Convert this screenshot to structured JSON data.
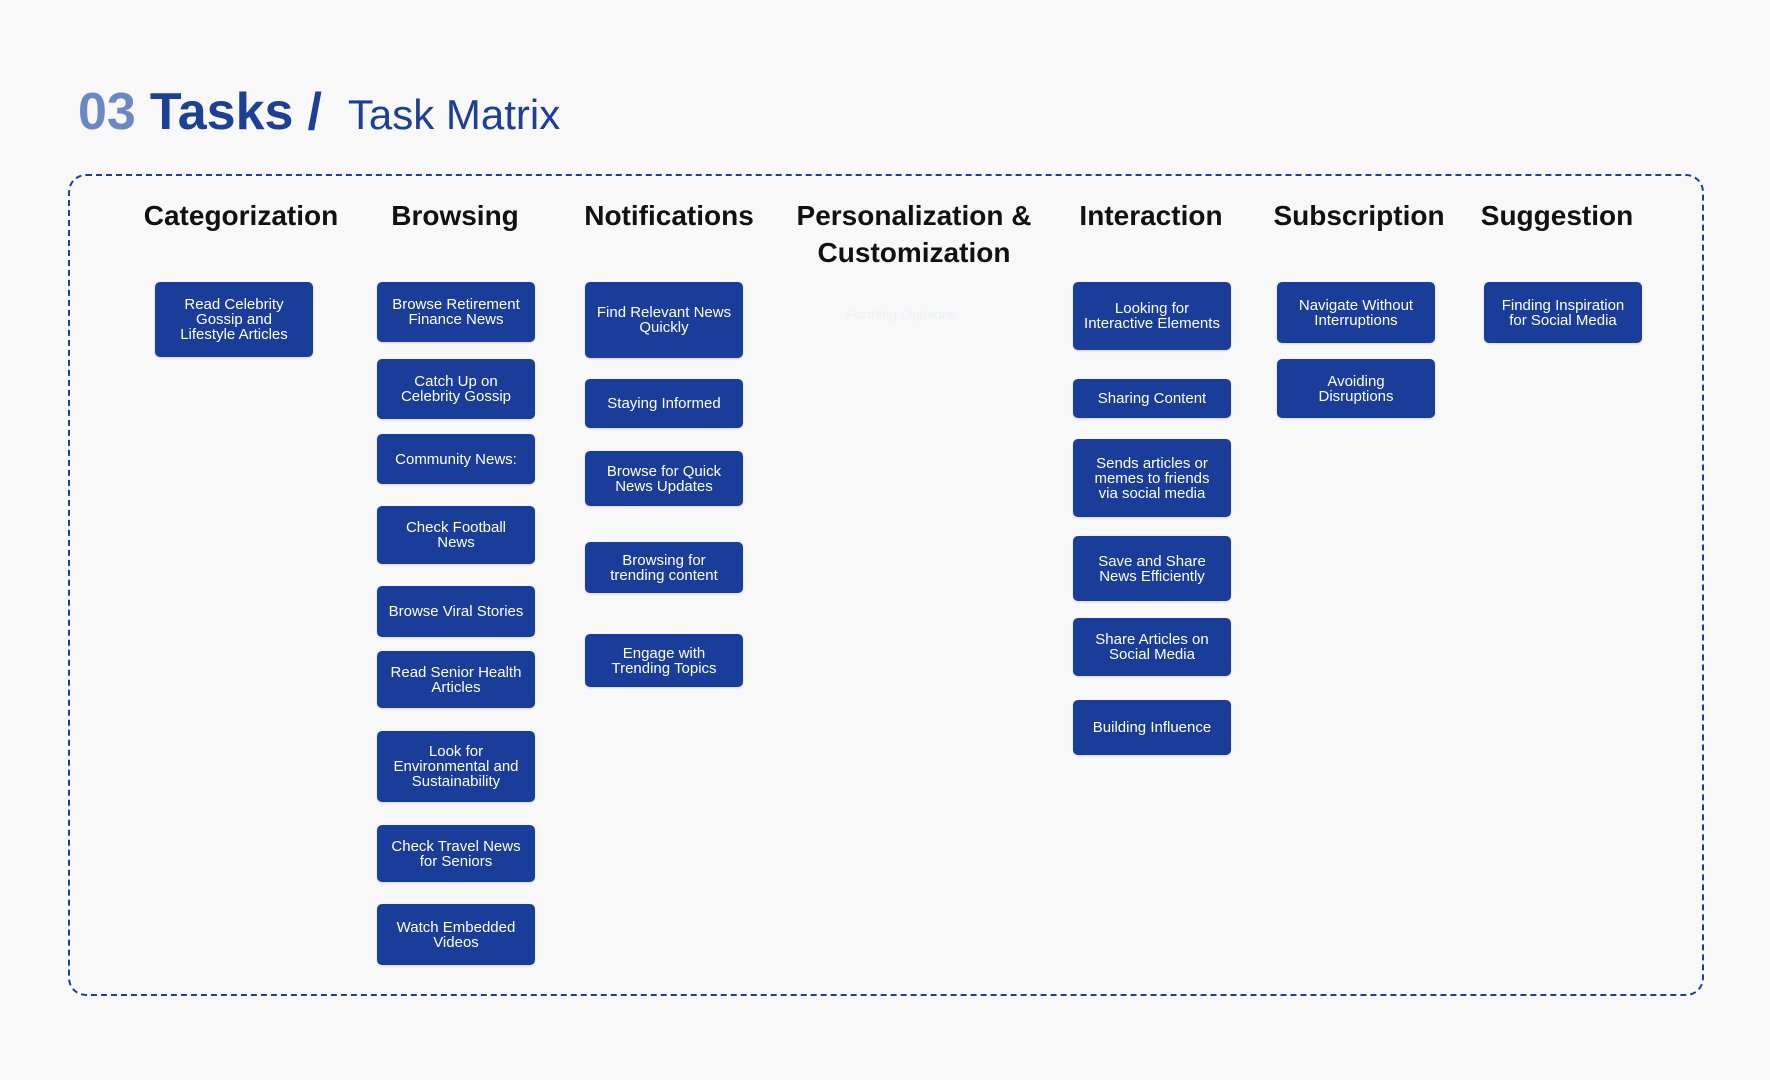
{
  "header": {
    "section_number": "03",
    "title": "Tasks",
    "separator": "/",
    "subtitle": "Task Matrix"
  },
  "colors": {
    "accent": "#1d3f94",
    "card": "#1a3d99",
    "section_number": "#6c88c4",
    "background": "#f8f8f9"
  },
  "columns": [
    {
      "title": "Categorization",
      "cards": [
        "Read Celebrity\nGossip and\nLifestyle Articles"
      ]
    },
    {
      "title": "Browsing",
      "cards": [
        "Browse Retirement\nFinance News",
        "Catch Up on\nCelebrity Gossip",
        "Community News:",
        "Check Football\nNews",
        "Browse Viral Stories",
        "Read Senior Health\nArticles",
        "Look for\nEnvironmental and\nSustainability",
        "Check Travel News\nfor Seniors",
        "Watch Embedded\nVideos"
      ]
    },
    {
      "title": "Notifications",
      "cards": [
        "Find Relevant News\nQuickly",
        "Staying Informed",
        "Browse for Quick\nNews Updates",
        "Browsing for\ntrending content",
        "Engage with\nTrending Topics"
      ]
    },
    {
      "title": "Personalization &\nCustomization",
      "cards": [],
      "faint_text": "Forming Opinions"
    },
    {
      "title": "Interaction",
      "cards": [
        "Looking for\nInteractive Elements",
        "Sharing Content",
        "Sends articles or\nmemes to friends\nvia social media",
        "Save and Share\nNews Efficiently",
        "Share Articles on\nSocial Media",
        "Building Influence"
      ]
    },
    {
      "title": "Subscription",
      "cards": [
        "Navigate Without\nInterruptions",
        "Avoiding\nDisruptions"
      ]
    },
    {
      "title": "Suggestion",
      "cards": [
        "Finding Inspiration\nfor Social Media"
      ]
    }
  ]
}
